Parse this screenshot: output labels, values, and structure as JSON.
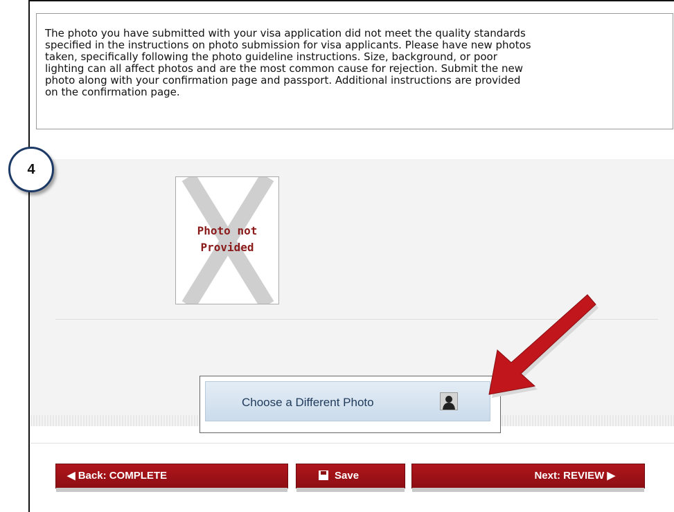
{
  "notice": {
    "lines": [
      "The photo you have submitted with your visa application did not meet the quality standards",
      "specified in the instructions on photo submission for visa applicants. Please have new photos",
      "taken, specifically following the photo guideline instructions. Size, background, or poor",
      "lighting can all affect photos and are the most common cause for rejection. Submit the new",
      "photo along with your confirmation page and passport. Additional instructions are provided",
      "on the confirmation page."
    ]
  },
  "step_badge": "4",
  "photo": {
    "line1": "Photo not",
    "line2": "Provided"
  },
  "choose_button": {
    "label": "Choose a Different Photo",
    "icon": "person-silhouette-icon"
  },
  "nav": {
    "back_label": "◀ Back: COMPLETE",
    "save_label": "Save",
    "next_label": "Next: REVIEW ▶"
  },
  "colors": {
    "nav_red": "#9e1217",
    "button_blue": "#cbdbeb",
    "arrow_red": "#c0161c",
    "badge_border": "#1d3a66"
  }
}
